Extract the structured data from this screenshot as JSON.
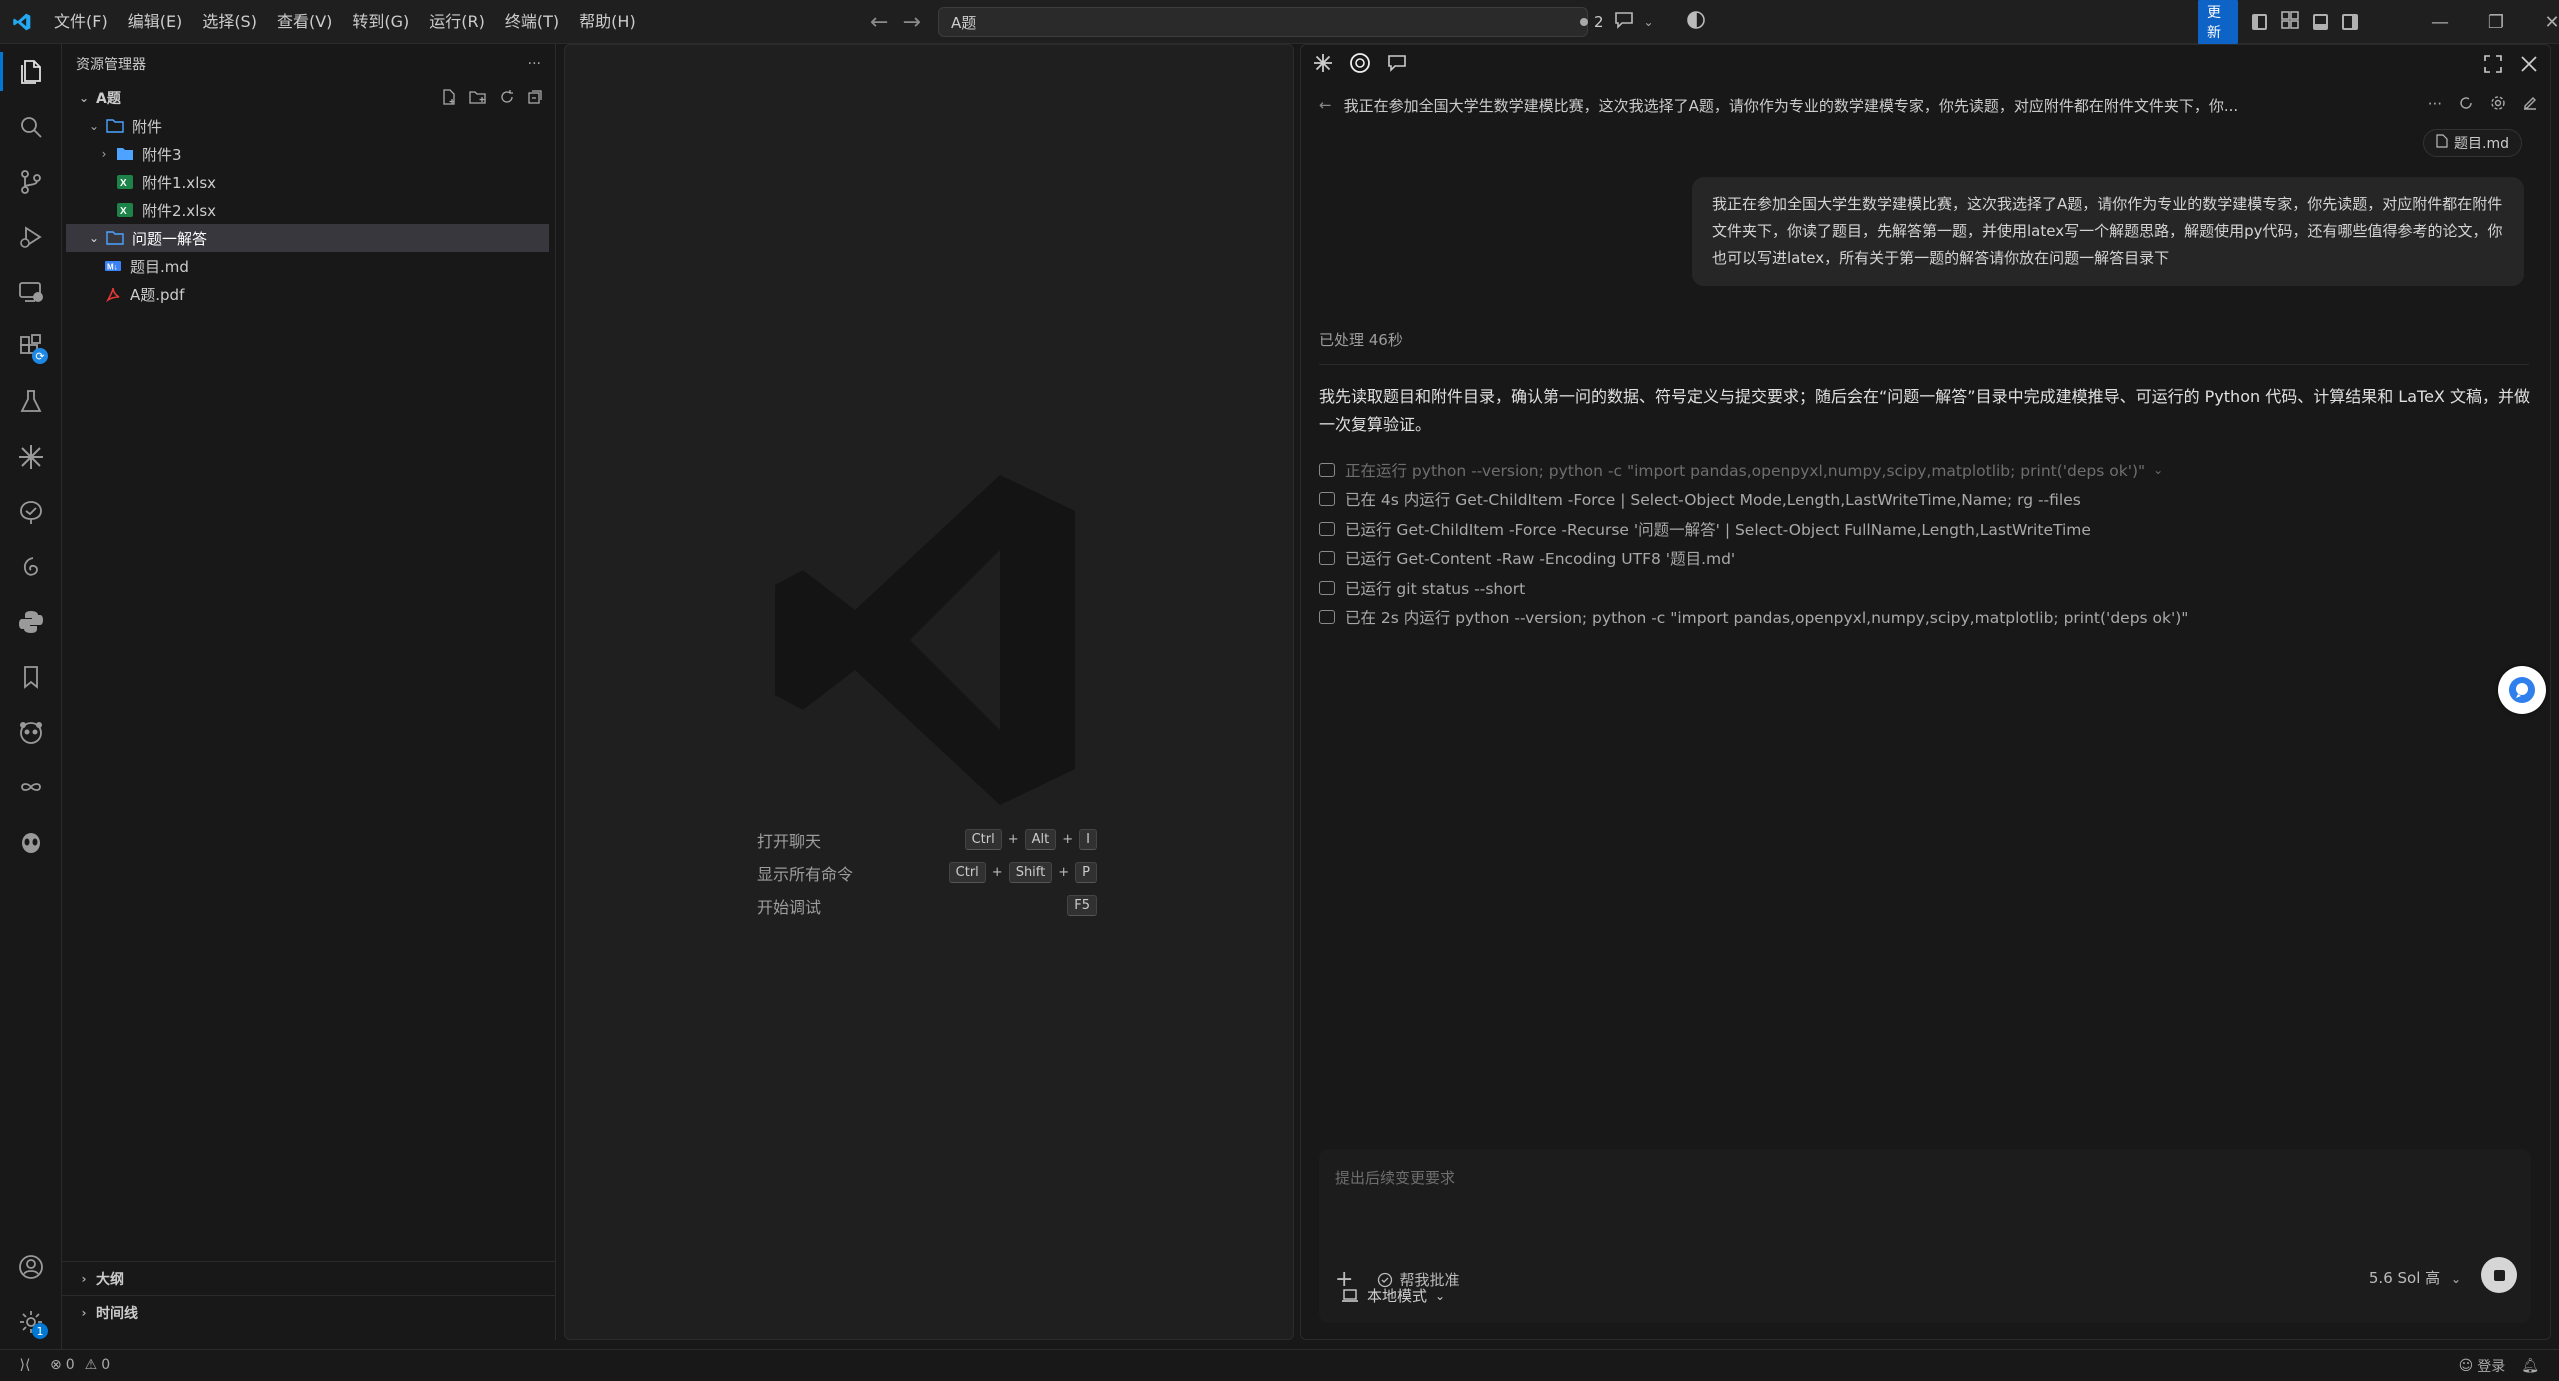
{
  "menu": [
    "文件(F)",
    "编辑(E)",
    "选择(S)",
    "查看(V)",
    "转到(G)",
    "运行(R)",
    "终端(T)",
    "帮助(H)"
  ],
  "search": {
    "value": "A题"
  },
  "titlebar": {
    "chat_count": "2",
    "update_label": "更新"
  },
  "sidebar": {
    "title": "资源管理器",
    "more": "···",
    "root": "A题",
    "tree": [
      {
        "label": "附件",
        "depth": 1,
        "expanded": true,
        "kind": "folder"
      },
      {
        "label": "附件3",
        "depth": 2,
        "expanded": false,
        "kind": "folder-filled"
      },
      {
        "label": "附件1.xlsx",
        "depth": 2,
        "kind": "excel"
      },
      {
        "label": "附件2.xlsx",
        "depth": 2,
        "kind": "excel"
      },
      {
        "label": "问题一解答",
        "depth": 1,
        "expanded": true,
        "kind": "folder",
        "selected": true
      },
      {
        "label": "题目.md",
        "depth": 1,
        "kind": "md"
      },
      {
        "label": "A题.pdf",
        "depth": 1,
        "kind": "pdf"
      }
    ],
    "outline": "大纲",
    "timeline": "时间线"
  },
  "activity_badges": {
    "extensions": "",
    "settings": "1"
  },
  "editor": {
    "shortcuts": [
      {
        "label": "打开聊天",
        "keys": [
          "Ctrl",
          "Alt",
          "I"
        ]
      },
      {
        "label": "显示所有命令",
        "keys": [
          "Ctrl",
          "Shift",
          "P"
        ]
      },
      {
        "label": "开始调试",
        "keys": [
          "F5"
        ]
      }
    ],
    "plus": "+"
  },
  "chat": {
    "title": "我正在参加全国大学生数学建模比赛，这次我选择了A题，请你作为专业的数学建模专家，你先读题，对应附件都在附件文件夹下，你...",
    "more": "···",
    "attachment": "题目.md",
    "user_message": "我正在参加全国大学生数学建模比赛，这次我选择了A题，请你作为专业的数学建模专家，你先读题，对应附件都在附件文件夹下，你读了题目，先解答第一题，并使用latex写一个解题思路，解题使用py代码，还有哪些值得参考的论文，你也可以写进latex，所有关于第一题的解答请你放在问题一解答目录下",
    "processed": "已处理 46秒",
    "assistant": "我先读取题目和附件目录，确认第一问的数据、符号定义与提交要求；随后会在“问题一解答”目录中完成建模推导、可运行的 Python 代码、计算结果和 LaTeX 文稿，并做一次复算验证。",
    "runs": [
      {
        "text": "正在运行 python --version; python -c \"import pandas,openpyxl,numpy,scipy,matplotlib; print('deps ok')\"",
        "dim": true
      },
      {
        "text": "已在 4s 内运行 Get-ChildItem -Force | Select-Object Mode,Length,LastWriteTime,Name; rg --files",
        "dim": false
      },
      {
        "text": "已运行 Get-ChildItem -Force -Recurse '问题一解答' | Select-Object FullName,Length,LastWriteTime",
        "dim": false
      },
      {
        "text": "已运行 Get-Content -Raw -Encoding UTF8 '题目.md'",
        "dim": false
      },
      {
        "text": "已运行 git status --short",
        "dim": false
      },
      {
        "text": "已在 2s 内运行 python --version; python -c \"import pandas,openpyxl,numpy,scipy,matplotlib; print('deps ok')\"",
        "dim": false
      }
    ],
    "input_placeholder": "提出后续变更要求",
    "add": "+",
    "approve_label": "帮我批准",
    "model_label": "5.6 Sol 高",
    "mode_label": "本地模式"
  },
  "status": {
    "errors": "0",
    "warnings": "0",
    "login": "登录"
  },
  "colors": {
    "accent": "#0078d4",
    "update": "#0e63c7"
  }
}
